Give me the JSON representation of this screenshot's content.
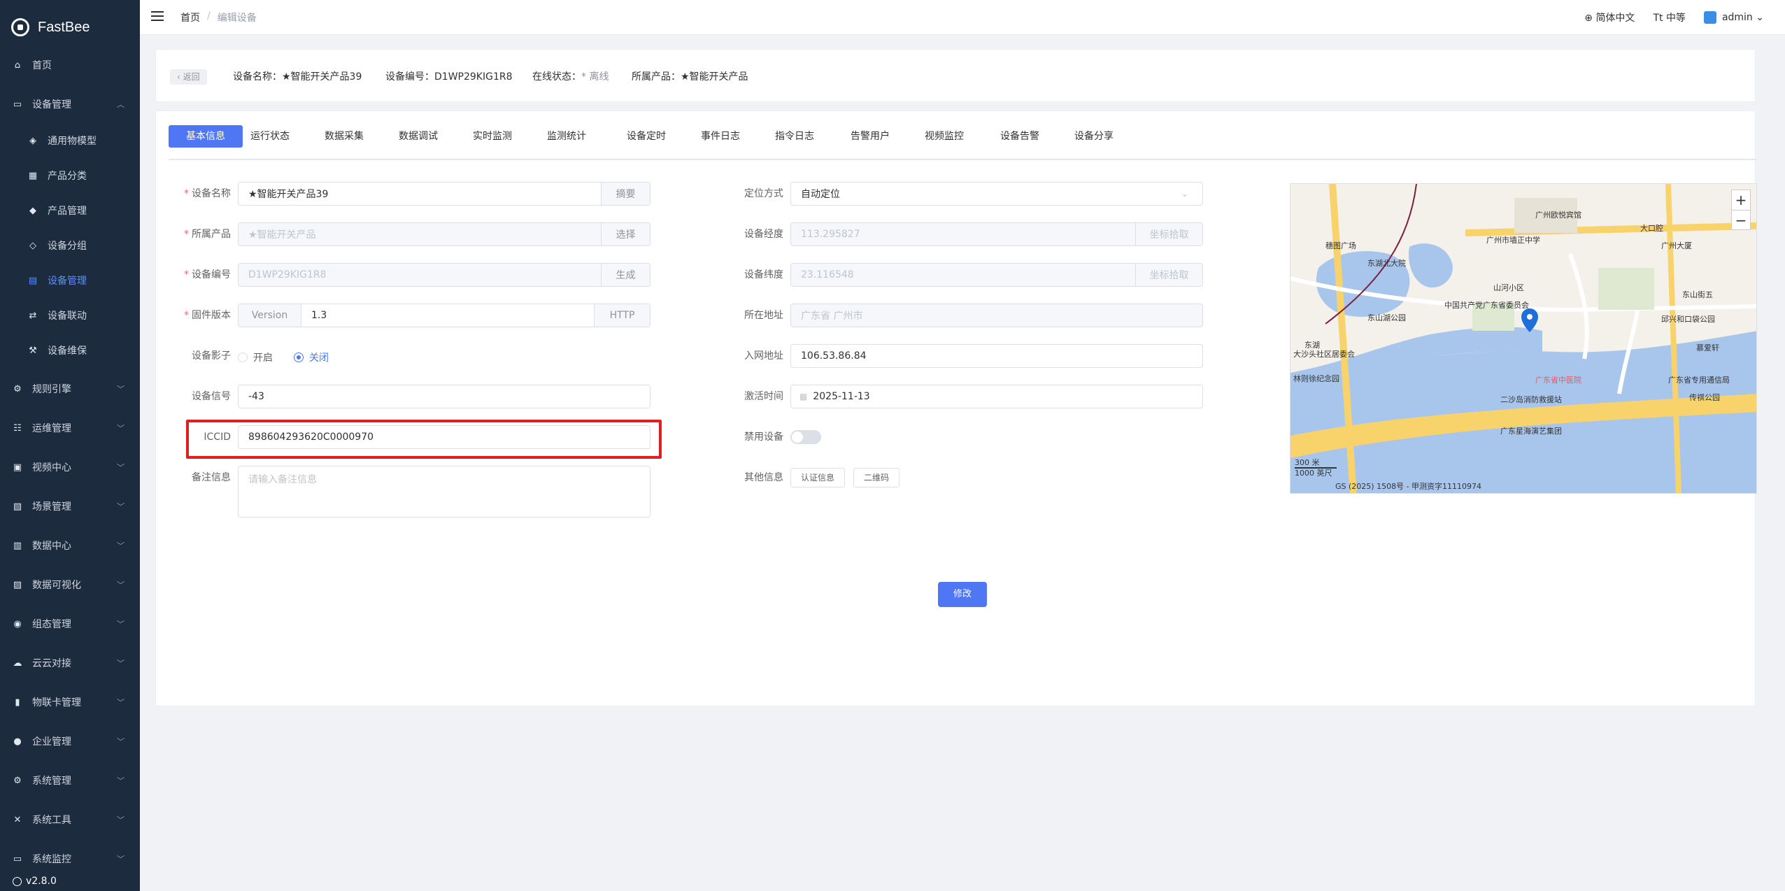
{
  "app": {
    "name": "FastBee",
    "version": "v2.8.0"
  },
  "sidebar": {
    "items": [
      {
        "label": "首页",
        "icon": "home-icon",
        "glyph": "⌂"
      },
      {
        "label": "设备管理",
        "icon": "monitor-icon",
        "glyph": "▭"
      },
      {
        "label": "通用物模型",
        "icon": "cube-icon",
        "glyph": "◈"
      },
      {
        "label": "产品分类",
        "icon": "grid-icon",
        "glyph": "▦"
      },
      {
        "label": "产品管理",
        "icon": "box-icon",
        "glyph": "◆"
      },
      {
        "label": "设备分组",
        "icon": "layers-icon",
        "glyph": "◇"
      },
      {
        "label": "设备管理",
        "icon": "list-icon",
        "glyph": "▤"
      },
      {
        "label": "设备联动",
        "icon": "link-icon",
        "glyph": "⇄"
      },
      {
        "label": "设备维保",
        "icon": "wrench-icon",
        "glyph": "⚒"
      },
      {
        "label": "规则引擎",
        "icon": "rule-icon",
        "glyph": "⚙"
      },
      {
        "label": "运维管理",
        "icon": "ops-icon",
        "glyph": "☷"
      },
      {
        "label": "视频中心",
        "icon": "video-icon",
        "glyph": "▣"
      },
      {
        "label": "场景管理",
        "icon": "scene-icon",
        "glyph": "▧"
      },
      {
        "label": "数据中心",
        "icon": "chart-icon",
        "glyph": "▥"
      },
      {
        "label": "数据可视化",
        "icon": "screen-icon",
        "glyph": "▨"
      },
      {
        "label": "组态管理",
        "icon": "config-icon",
        "glyph": "◉"
      },
      {
        "label": "云云对接",
        "icon": "cloud-icon",
        "glyph": "☁"
      },
      {
        "label": "物联卡管理",
        "icon": "card-icon",
        "glyph": "▮"
      },
      {
        "label": "企业管理",
        "icon": "enterprise-icon",
        "glyph": "●"
      },
      {
        "label": "系统管理",
        "icon": "system-icon",
        "glyph": "⚙"
      },
      {
        "label": "系统工具",
        "icon": "tools-icon",
        "glyph": "✕"
      },
      {
        "label": "系统监控",
        "icon": "monitor-sys-icon",
        "glyph": "▭"
      }
    ]
  },
  "header": {
    "breadcrumb": [
      "首页",
      "编辑设备"
    ],
    "language": "简体中文",
    "size": "中等",
    "user": "admin"
  },
  "device_header": {
    "back": "返回",
    "name_label": "设备名称：",
    "name_value": "★智能开关产品39",
    "serial_label": "设备编号：",
    "serial_value": "D1WP29KIG1R8",
    "status_label": "在线状态：",
    "status_value": "* 离线",
    "product_label": "所属产品：",
    "product_value": "★智能开关产品"
  },
  "tabs": [
    "基本信息",
    "运行状态",
    "数据采集",
    "数据调试",
    "实时监测",
    "监测统计",
    "设备定时",
    "事件日志",
    "指令日志",
    "告警用户",
    "视频监控",
    "设备告警",
    "设备分享"
  ],
  "form_left": {
    "device_name": {
      "label": "设备名称",
      "value": "★智能开关产品39",
      "addon": "摘要"
    },
    "product": {
      "label": "所属产品",
      "value": "★智能开关产品",
      "addon": "选择"
    },
    "serial": {
      "label": "设备编号",
      "value": "D1WP29KIG1R8",
      "addon": "生成"
    },
    "firmware": {
      "label": "固件版本",
      "prefix": "Version",
      "value": "1.3",
      "addon": "HTTP"
    },
    "shadow": {
      "label": "设备影子",
      "on": "开启",
      "off": "关闭"
    },
    "signal": {
      "label": "设备信号",
      "value": "-43"
    },
    "iccid": {
      "label": "ICCID",
      "value": "898604293620C0000970"
    },
    "remark": {
      "label": "备注信息",
      "placeholder": "请输入备注信息"
    }
  },
  "form_right": {
    "locate": {
      "label": "定位方式",
      "value": "自动定位"
    },
    "longitude": {
      "label": "设备经度",
      "value": "113.295827",
      "addon": "坐标拾取"
    },
    "latitude": {
      "label": "设备纬度",
      "value": "23.116548",
      "addon": "坐标拾取"
    },
    "address": {
      "label": "所在地址",
      "value": "广东省 广州市"
    },
    "ip": {
      "label": "入网地址",
      "value": "106.53.86.84"
    },
    "active_time": {
      "label": "激活时间",
      "value": "2025-11-13"
    },
    "disable": {
      "label": "禁用设备"
    },
    "other": {
      "label": "其他信息",
      "auth_btn": "认证信息",
      "qr_btn": "二维码"
    }
  },
  "submit": "修改",
  "map": {
    "labels": [
      "广州欧悦宾馆",
      "广州市墙正中学",
      "东湖北大院",
      "山河小区",
      "中国共产党广东省委员会",
      "东山湖公园",
      "大沙头社区居委会",
      "林则徐纪念园",
      "广东省中医院",
      "二沙岛消防救援站",
      "广东省专用通信局",
      "传祺公园",
      "广东星海演艺集团",
      "东山街五",
      "邱兴和口袋公园",
      "慕爱轩",
      "大口腔",
      "广州大厦",
      "穗图广场",
      "东湖"
    ],
    "scale_top": "300 米",
    "scale_bottom": "1000 英尺",
    "copyright": "GS (2025) 1508号 - 甲测资字11110974"
  },
  "colors": {
    "accent": "#4f77f3",
    "sidebar": "#1d2b3e",
    "highlight": "#e02020"
  }
}
